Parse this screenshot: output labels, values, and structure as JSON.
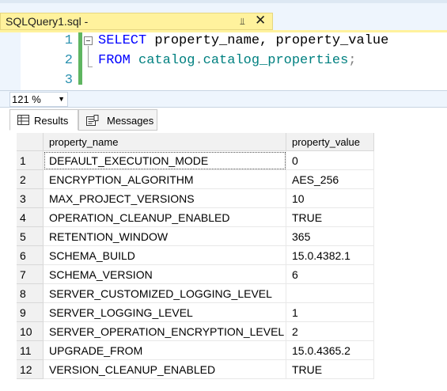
{
  "tab": {
    "title": "SQLQuery1.sql -",
    "pin_icon": "pin-icon",
    "close_icon": "close-icon"
  },
  "editor": {
    "lines": [
      {
        "num": "1",
        "parts": [
          {
            "t": "SELECT",
            "c": "kw"
          },
          {
            "t": " property_name, property_value",
            "c": "plain"
          }
        ]
      },
      {
        "num": "2",
        "parts": [
          {
            "t": "FROM",
            "c": "kw"
          },
          {
            "t": " catalog",
            "c": "obj"
          },
          {
            "t": ".",
            "c": "punct"
          },
          {
            "t": "catalog_properties",
            "c": "obj"
          },
          {
            "t": ";",
            "c": "punct"
          }
        ]
      },
      {
        "num": "3",
        "parts": []
      }
    ]
  },
  "zoom": {
    "value": "121 %"
  },
  "results_tabs": [
    {
      "label": "Results",
      "icon": "grid-icon",
      "active": true
    },
    {
      "label": "Messages",
      "icon": "messages-icon",
      "active": false
    }
  ],
  "grid": {
    "columns": [
      "property_name",
      "property_value"
    ],
    "rows": [
      {
        "n": "1",
        "name": "DEFAULT_EXECUTION_MODE",
        "value": "0"
      },
      {
        "n": "2",
        "name": "ENCRYPTION_ALGORITHM",
        "value": "AES_256"
      },
      {
        "n": "3",
        "name": "MAX_PROJECT_VERSIONS",
        "value": "10"
      },
      {
        "n": "4",
        "name": "OPERATION_CLEANUP_ENABLED",
        "value": "TRUE"
      },
      {
        "n": "5",
        "name": "RETENTION_WINDOW",
        "value": "365"
      },
      {
        "n": "6",
        "name": "SCHEMA_BUILD",
        "value": "15.0.4382.1"
      },
      {
        "n": "7",
        "name": "SCHEMA_VERSION",
        "value": "6"
      },
      {
        "n": "8",
        "name": "SERVER_CUSTOMIZED_LOGGING_LEVEL",
        "value": ""
      },
      {
        "n": "9",
        "name": "SERVER_LOGGING_LEVEL",
        "value": "1"
      },
      {
        "n": "10",
        "name": "SERVER_OPERATION_ENCRYPTION_LEVEL",
        "value": "2"
      },
      {
        "n": "11",
        "name": "UPGRADE_FROM",
        "value": "15.0.4365.2"
      },
      {
        "n": "12",
        "name": "VERSION_CLEANUP_ENABLED",
        "value": "TRUE"
      }
    ]
  },
  "colors": {
    "tab_active": "#fff29d",
    "keyword": "#0000ff",
    "object": "#008080",
    "line_number": "#2b91af"
  }
}
